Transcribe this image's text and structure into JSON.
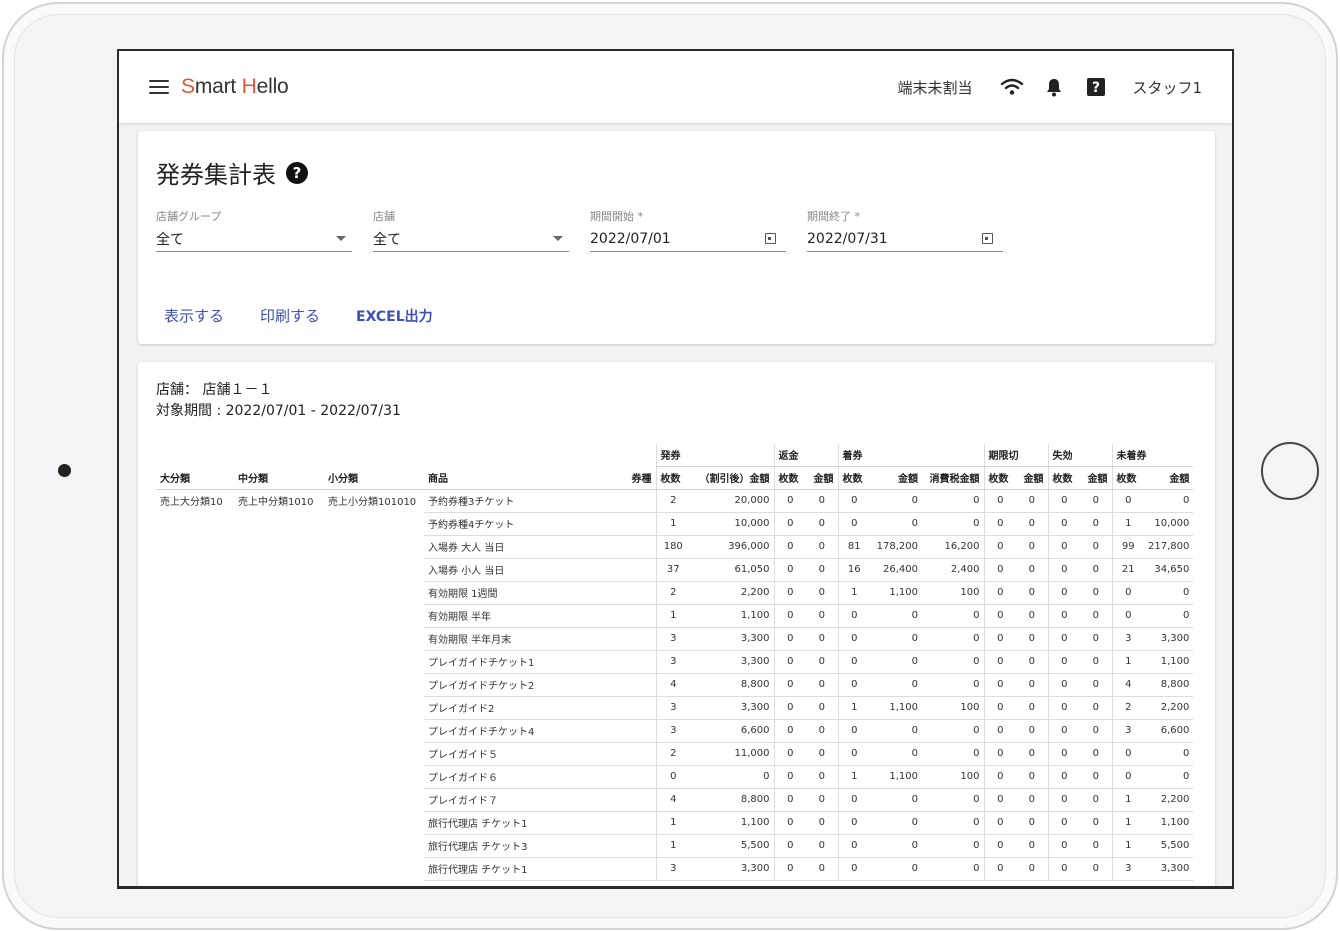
{
  "app": {
    "brand_first": "S",
    "brand_mid": "mart ",
    "brand_h": "H",
    "brand_rest": "ello",
    "accent_color": "#e2553a"
  },
  "header": {
    "terminal": "端末未割当",
    "staff": "スタッフ1",
    "icons": [
      "menu-icon",
      "wifi-icon",
      "bell-icon",
      "help-icon"
    ]
  },
  "filter": {
    "title": "発券集計表",
    "fields": {
      "store_group": {
        "label": "店舗グループ",
        "value": "全て"
      },
      "store": {
        "label": "店舗",
        "value": "全て"
      },
      "start": {
        "label": "期間開始 *",
        "value": "2022/07/01"
      },
      "end": {
        "label": "期間終了 *",
        "value": "2022/07/31"
      }
    },
    "actions": {
      "show": "表示する",
      "print": "印刷する",
      "excel": "EXCEL出力"
    },
    "link_color": "#3f51b5"
  },
  "report": {
    "store_line": "店舗： 店舗１－１",
    "period_line": "対象期間 : 2022/07/01 - 2022/07/31",
    "group_headers": [
      "発券",
      "返金",
      "着券",
      "期限切",
      "失効",
      "未着券"
    ],
    "columns": [
      "大分類",
      "中分類",
      "小分類",
      "商品",
      "券種",
      "枚数",
      "（割引後）金額",
      "枚数",
      "金額",
      "枚数",
      "金額",
      "消費税金額",
      "枚数",
      "金額",
      "枚数",
      "金額",
      "枚数",
      "金額"
    ],
    "category": {
      "large": "売上大分類10",
      "mid": "売上中分類1010",
      "small": "売上小分類101010"
    },
    "rows": [
      {
        "product": "予約券種3チケット",
        "v": [
          "2",
          "20,000",
          "0",
          "0",
          "0",
          "0",
          "0",
          "0",
          "0",
          "0",
          "0",
          "0",
          "0"
        ]
      },
      {
        "product": "予約券種4チケット",
        "v": [
          "1",
          "10,000",
          "0",
          "0",
          "0",
          "0",
          "0",
          "0",
          "0",
          "0",
          "0",
          "1",
          "10,000"
        ]
      },
      {
        "product": "入場券 大人 当日",
        "v": [
          "180",
          "396,000",
          "0",
          "0",
          "81",
          "178,200",
          "16,200",
          "0",
          "0",
          "0",
          "0",
          "99",
          "217,800"
        ]
      },
      {
        "product": "入場券 小人 当日",
        "v": [
          "37",
          "61,050",
          "0",
          "0",
          "16",
          "26,400",
          "2,400",
          "0",
          "0",
          "0",
          "0",
          "21",
          "34,650"
        ]
      },
      {
        "product": "有効期限 1週間",
        "v": [
          "2",
          "2,200",
          "0",
          "0",
          "1",
          "1,100",
          "100",
          "0",
          "0",
          "0",
          "0",
          "0",
          "0"
        ]
      },
      {
        "product": "有効期限 半年",
        "v": [
          "1",
          "1,100",
          "0",
          "0",
          "0",
          "0",
          "0",
          "0",
          "0",
          "0",
          "0",
          "0",
          "0"
        ]
      },
      {
        "product": "有効期限 半年月末",
        "v": [
          "3",
          "3,300",
          "0",
          "0",
          "0",
          "0",
          "0",
          "0",
          "0",
          "0",
          "0",
          "3",
          "3,300"
        ]
      },
      {
        "product": "プレイガイドチケット1",
        "v": [
          "3",
          "3,300",
          "0",
          "0",
          "0",
          "0",
          "0",
          "0",
          "0",
          "0",
          "0",
          "1",
          "1,100"
        ]
      },
      {
        "product": "プレイガイドチケット2",
        "v": [
          "4",
          "8,800",
          "0",
          "0",
          "0",
          "0",
          "0",
          "0",
          "0",
          "0",
          "0",
          "4",
          "8,800"
        ]
      },
      {
        "product": "プレイガイド2",
        "v": [
          "3",
          "3,300",
          "0",
          "0",
          "1",
          "1,100",
          "100",
          "0",
          "0",
          "0",
          "0",
          "2",
          "2,200"
        ]
      },
      {
        "product": "プレイガイドチケット4",
        "v": [
          "3",
          "6,600",
          "0",
          "0",
          "0",
          "0",
          "0",
          "0",
          "0",
          "0",
          "0",
          "3",
          "6,600"
        ]
      },
      {
        "product": "プレイガイド５",
        "v": [
          "2",
          "11,000",
          "0",
          "0",
          "0",
          "0",
          "0",
          "0",
          "0",
          "0",
          "0",
          "0",
          "0"
        ]
      },
      {
        "product": "プレイガイド６",
        "v": [
          "0",
          "0",
          "0",
          "0",
          "1",
          "1,100",
          "100",
          "0",
          "0",
          "0",
          "0",
          "0",
          "0"
        ]
      },
      {
        "product": "プレイガイド７",
        "v": [
          "4",
          "8,800",
          "0",
          "0",
          "0",
          "0",
          "0",
          "0",
          "0",
          "0",
          "0",
          "1",
          "2,200"
        ]
      },
      {
        "product": "旅行代理店 チケット1",
        "v": [
          "1",
          "1,100",
          "0",
          "0",
          "0",
          "0",
          "0",
          "0",
          "0",
          "0",
          "0",
          "1",
          "1,100"
        ]
      },
      {
        "product": "旅行代理店 チケット3",
        "v": [
          "1",
          "5,500",
          "0",
          "0",
          "0",
          "0",
          "0",
          "0",
          "0",
          "0",
          "0",
          "1",
          "5,500"
        ]
      },
      {
        "product": "旅行代理店 チケット1",
        "v": [
          "3",
          "3,300",
          "0",
          "0",
          "0",
          "0",
          "0",
          "0",
          "0",
          "0",
          "0",
          "3",
          "3,300"
        ]
      }
    ]
  }
}
